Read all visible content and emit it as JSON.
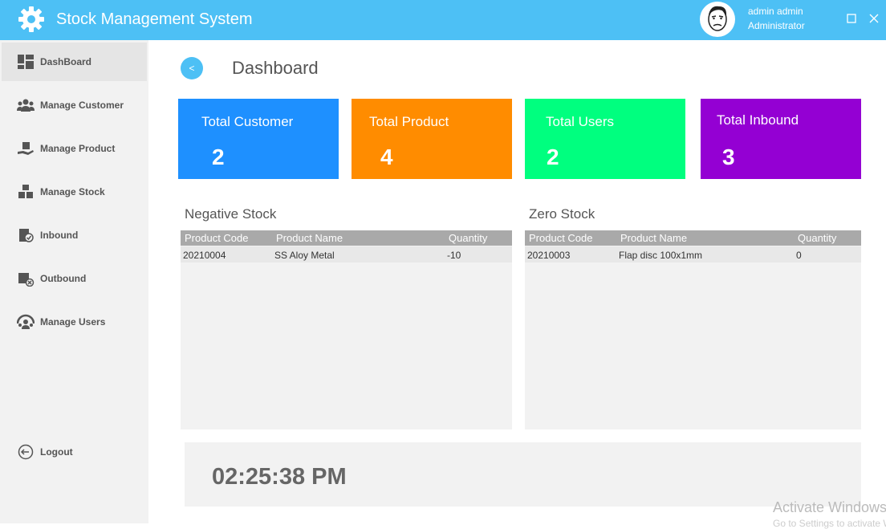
{
  "app": {
    "title": "Stock Management System"
  },
  "user": {
    "name": "admin admin",
    "role": "Administrator"
  },
  "sidebar": {
    "items": [
      {
        "label": "DashBoard",
        "icon": "dashboard-icon",
        "active": true
      },
      {
        "label": "Manage Customer",
        "icon": "customers-icon"
      },
      {
        "label": "Manage Product",
        "icon": "product-icon"
      },
      {
        "label": "Manage Stock",
        "icon": "stock-icon"
      },
      {
        "label": "Inbound",
        "icon": "inbound-icon"
      },
      {
        "label": "Outbound",
        "icon": "outbound-icon"
      },
      {
        "label": "Manage Users",
        "icon": "users-icon"
      }
    ],
    "logout": "Logout"
  },
  "page": {
    "back_label": "<",
    "title": "Dashboard"
  },
  "cards": [
    {
      "label": "Total Customer",
      "value": "2",
      "color": "#1e90ff"
    },
    {
      "label": "Total Product",
      "value": "4",
      "color": "#ff8c00"
    },
    {
      "label": "Total Users",
      "value": "2",
      "color": "#00ff7f"
    },
    {
      "label": "Total Inbound",
      "value": "3",
      "color": "#9400d3"
    }
  ],
  "negative_stock": {
    "title": "Negative Stock",
    "columns": [
      "Product Code",
      "Product Name",
      "Quantity"
    ],
    "rows": [
      [
        "20210004",
        "SS Aloy Metal",
        "-10"
      ]
    ]
  },
  "zero_stock": {
    "title": "Zero Stock",
    "columns": [
      "Product Code",
      "Product Name",
      "Quantity"
    ],
    "rows": [
      [
        "20210003",
        "Flap disc 100x1mm",
        "0"
      ]
    ]
  },
  "clock": "02:25:38 PM",
  "watermark": {
    "line1": "Activate Windows",
    "line2": "Go to Settings to activate Windows."
  },
  "colors": {
    "titlebar": "#4dc0f5",
    "sidebar": "#f2f2f2",
    "grid_header": "#a9a9a9"
  }
}
